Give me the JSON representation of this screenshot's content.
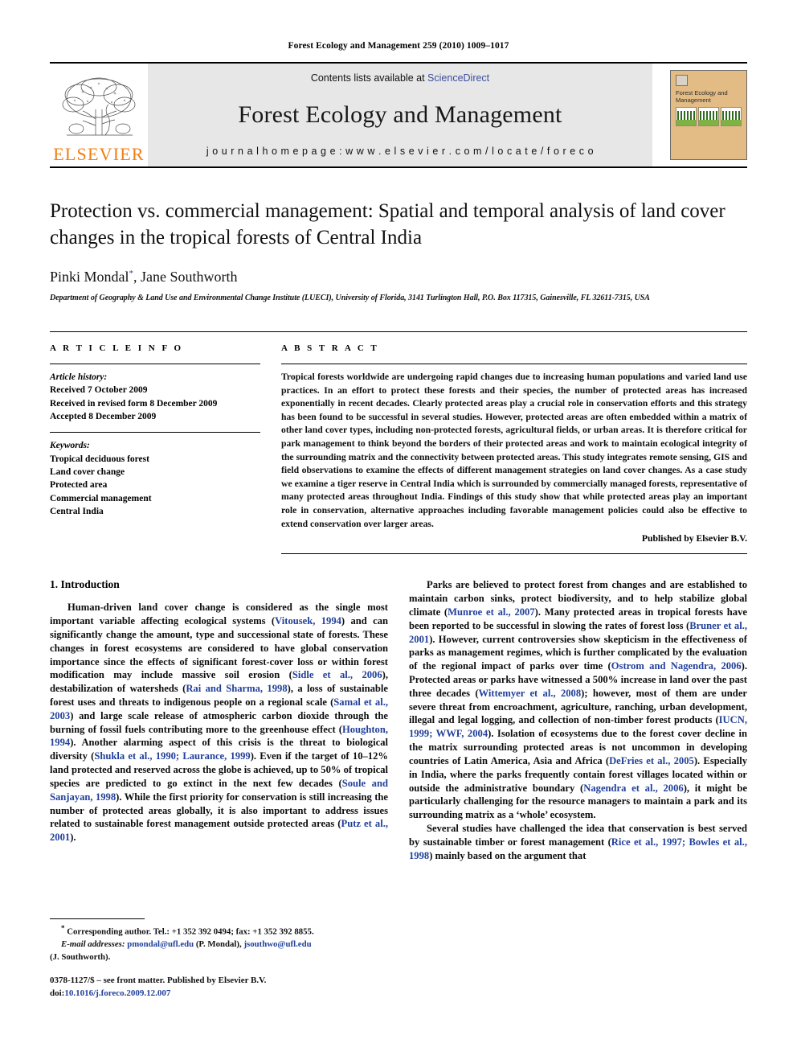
{
  "running_head": "Forest Ecology and Management 259 (2010) 1009–1017",
  "masthead": {
    "publisher_wordmark": "ELSEVIER",
    "contents_prefix": "Contents lists available at ",
    "sciencedirect": "ScienceDirect",
    "journal_title": "Forest Ecology and Management",
    "homepage": "j o u r n a l  h o m e p a g e :  w w w . e l s e v i e r . c o m / l o c a t e / f o r e c o",
    "cover_title": "Forest Ecology and Management",
    "sciencedirect_color": "#3b4ea0",
    "elsevier_orange": "#F07E12",
    "band_bg": "#e7e7e7",
    "cover_bg": "#e2bb85"
  },
  "article": {
    "title": "Protection vs. commercial management: Spatial and temporal analysis of land cover changes in the tropical forests of Central India",
    "authors": "Pinki Mondal",
    "authors_rest": ", Jane Southworth",
    "corresponding_marker": "*",
    "affiliation": "Department of Geography & Land Use and Environmental Change Institute (LUECI), University of Florida, 3141 Turlington Hall, P.O. Box 117315, Gainesville, FL 32611-7315, USA"
  },
  "article_info": {
    "label": "A R T I C L E   I N F O",
    "history_label": "Article history:",
    "history": [
      "Received 7 October 2009",
      "Received in revised form 8 December 2009",
      "Accepted 8 December 2009"
    ],
    "keywords_label": "Keywords:",
    "keywords": [
      "Tropical deciduous forest",
      "Land cover change",
      "Protected area",
      "Commercial management",
      "Central India"
    ]
  },
  "abstract": {
    "label": "A B S T R A C T",
    "text": "Tropical forests worldwide are undergoing rapid changes due to increasing human populations and varied land use practices. In an effort to protect these forests and their species, the number of protected areas has increased exponentially in recent decades. Clearly protected areas play a crucial role in conservation efforts and this strategy has been found to be successful in several studies. However, protected areas are often embedded within a matrix of other land cover types, including non-protected forests, agricultural fields, or urban areas. It is therefore critical for park management to think beyond the borders of their protected areas and work to maintain ecological integrity of the surrounding matrix and the connectivity between protected areas. This study integrates remote sensing, GIS and field observations to examine the effects of different management strategies on land cover changes. As a case study we examine a tiger reserve in Central India which is surrounded by commercially managed forests, representative of many protected areas throughout India. Findings of this study show that while protected areas play an important role in conservation, alternative approaches including favorable management policies could also be effective to extend conservation over larger areas.",
    "published_by": "Published by Elsevier B.V."
  },
  "introduction": {
    "heading": "1.  Introduction",
    "left_paragraph_1_a": "Human-driven land cover change is considered as the single most important variable affecting ecological systems (",
    "cite_vitousek": "Vitousek, 1994",
    "left_paragraph_1_b": ") and can significantly change the amount, type and successional state of forests. These changes in forest ecosystems are considered to have global conservation importance since the effects of significant forest-cover loss or within forest modification may include massive soil erosion (",
    "cite_sidle": "Sidle et al., 2006",
    "left_paragraph_1_c": "), destabilization of watersheds (",
    "cite_rai": "Rai and Sharma, 1998",
    "left_paragraph_1_d": "), a loss of sustainable forest uses and threats to indigenous people on a regional scale (",
    "cite_samal": "Samal et al., 2003",
    "left_paragraph_1_e": ") and large scale release of atmospheric carbon dioxide through the burning of fossil fuels contributing more to the greenhouse effect (",
    "cite_houghton": "Houghton, 1994",
    "left_paragraph_1_f": "). Another alarming aspect of this crisis is the threat to biological diversity (",
    "cite_shukla": "Shukla et al., 1990; Laurance, 1999",
    "left_paragraph_1_g": "). Even if the target of 10–12% land protected and reserved across the globe is achieved, up to 50% of tropical species are predicted to go extinct in the next few decades (",
    "cite_soule": "Soule and Sanjayan, 1998",
    "left_paragraph_1_h": "). While the first priority for conservation is still increasing the number of protected areas globally, it is also important to address issues related to sustainable forest management outside protected areas (",
    "cite_putz": "Putz et al., 2001",
    "left_paragraph_1_i": ").",
    "right_paragraph_2_a": "Parks are believed to protect forest from changes and are established to maintain carbon sinks, protect biodiversity, and to help stabilize global climate (",
    "cite_munroe": "Munroe et al., 2007",
    "right_paragraph_2_b": "). Many protected areas in tropical forests have been reported to be successful in slowing the rates of forest loss (",
    "cite_bruner": "Bruner et al., 2001",
    "right_paragraph_2_c": "). However, current controversies show skepticism in the effectiveness of parks as management regimes, which is further complicated by the evaluation of the regional impact of parks over time (",
    "cite_ostrom": "Ostrom and Nagendra, 2006",
    "right_paragraph_2_d": "). Protected areas or parks have witnessed a 500% increase in land over the past three decades (",
    "cite_wittemyer": "Wittemyer et al., 2008",
    "right_paragraph_2_e": "); however, most of them are under severe threat from encroachment, agriculture, ranching, urban development, illegal and legal logging, and collection of non-timber forest products (",
    "cite_iucn": "IUCN, 1999; WWF, 2004",
    "right_paragraph_2_f": "). Isolation of ecosystems due to the forest cover decline in the matrix surrounding protected areas is not uncommon in developing countries of Latin America, Asia and Africa (",
    "cite_defries": "DeFries et al., 2005",
    "right_paragraph_2_g": "). Especially in India, where the parks frequently contain forest villages located within or outside the administrative boundary (",
    "cite_nagendra": "Nagendra et al., 2006",
    "right_paragraph_2_h": "), it might be particularly challenging for the resource managers to maintain a park and its surrounding matrix as a ‘whole’ ecosystem.",
    "right_paragraph_3_a": "Several studies have challenged the idea that conservation is best served by sustainable timber or forest management (",
    "cite_rice": "Rice et al., 1997; Bowles et al., 1998",
    "right_paragraph_3_b": ") mainly based on the argument that"
  },
  "footnote": {
    "marker": "*",
    "corresponding": " Corresponding author. Tel.: +1 352 392 0494; fax: +1 352 392 8855.",
    "email_label": "E-mail addresses:",
    "email_1": "pmondal@ufl.edu",
    "email_1_name": " (P. Mondal),",
    "email_2": "jsouthwo@ufl.edu",
    "email_2_name": "(J. Southworth).",
    "link_color": "#21409a"
  },
  "imprint": {
    "front_matter": "0378-1127/$ – see front matter. Published by Elsevier B.V.",
    "doi_label": "doi:",
    "doi": "10.1016/j.foreco.2009.12.007"
  }
}
